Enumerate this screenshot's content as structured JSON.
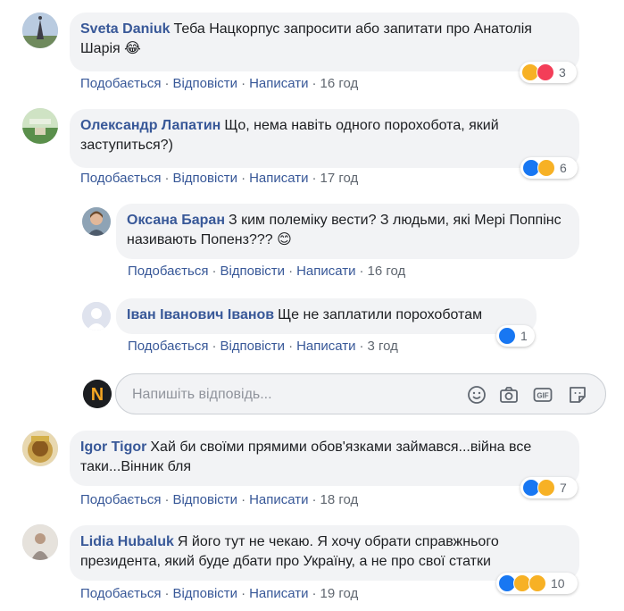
{
  "colors": {
    "author": "#385898",
    "action": "#385898",
    "meta": "#606770",
    "bubble": "#f2f3f5",
    "like": "#1877f2",
    "haha": "#f7b125",
    "love": "#f33e58"
  },
  "actions": {
    "like": "Подобається",
    "reply": "Відповісти",
    "message": "Написати",
    "dot": "·"
  },
  "comments": [
    {
      "author": "Sveta Daniuk",
      "text": "Теба Нацкорпус запросити або запитати про Анатолія Шарія 😂",
      "time": "16 год",
      "reactions": [
        "haha",
        "love"
      ],
      "reaction_count": "3"
    },
    {
      "author": "Олександр Лапатин",
      "text": "Що, нема навіть одного порохобота, який заступиться?)",
      "time": "17 год",
      "reactions": [
        "like",
        "haha"
      ],
      "reaction_count": "6",
      "replies": [
        {
          "author": "Оксана Баран",
          "text": "З ким полеміку вести? З людьми, які Мері Поппінс називають Попенз??? 😊",
          "time": "16 год"
        },
        {
          "author": "Іван Іванович Іванов",
          "text": "Ще не заплатили порохоботам",
          "time": "3 год",
          "reactions": [
            "like"
          ],
          "reaction_count": "1"
        }
      ]
    },
    {
      "author": "Igor Tigor",
      "text": "Хай би своїми прямими обов'язками займався...війна все таки...Вінник бля",
      "time": "18 год",
      "reactions": [
        "like",
        "haha"
      ],
      "reaction_count": "7"
    },
    {
      "author": "Lidia Hubaluk",
      "text": "Я його тут не чекаю. Я хочу обрати справжнього президента, який буде дбати про Україну, а не про свої статки",
      "time": "19 год",
      "reactions": [
        "like",
        "haha",
        "sad"
      ],
      "reaction_count": "10"
    }
  ],
  "reply_box": {
    "placeholder": "Напишіть відповідь...",
    "icons": [
      "emoji-icon",
      "camera-icon",
      "gif-icon",
      "sticker-icon"
    ],
    "gif_label": "GIF",
    "user_avatar_letter": "N"
  }
}
